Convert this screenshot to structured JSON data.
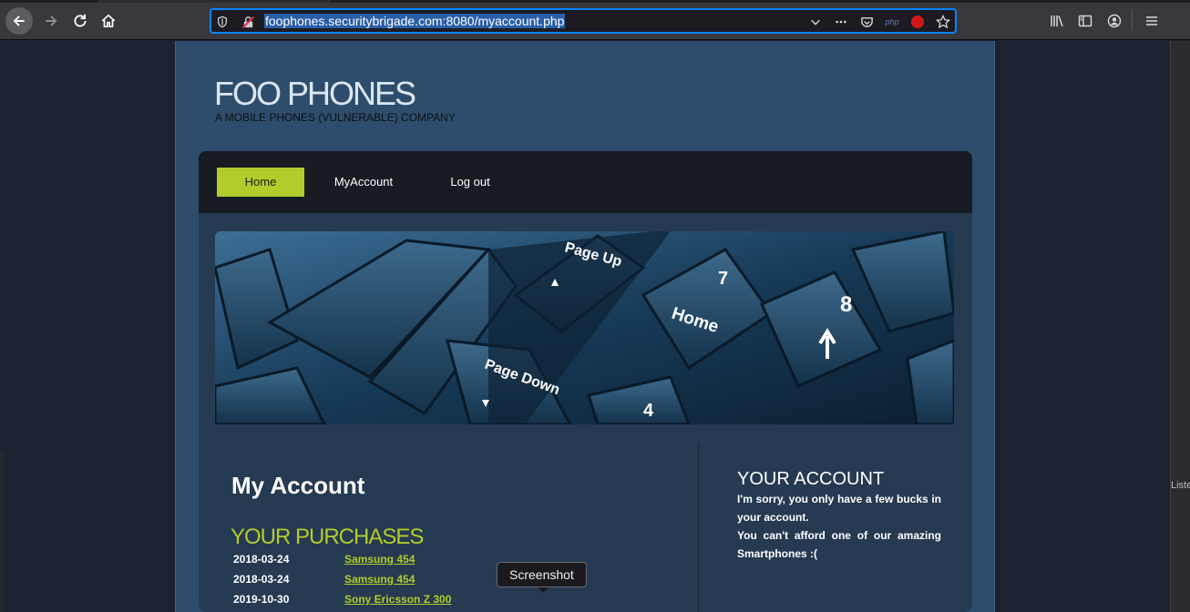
{
  "browser": {
    "url": "foophones.securitybrigade.com:8080/myaccount.php",
    "ext_label": "php"
  },
  "site": {
    "logo": "FOO PHONES",
    "tagline": "A MOBILE PHONES (VULNERABLE) COMPANY",
    "nav": [
      "Home",
      "MyAccount",
      "Log out"
    ],
    "banner_keys": [
      "Page Up",
      "Page Down",
      "Home",
      "7",
      "8",
      "4"
    ]
  },
  "main": {
    "heading": "My Account",
    "purchases_heading": "YOUR PURCHASES",
    "purchases": [
      {
        "date": "2018-03-24",
        "product": "Samsung 454"
      },
      {
        "date": "2018-03-24",
        "product": "Samsung 454"
      },
      {
        "date": "2019-10-30",
        "product": "Sony Ericsson Z 300"
      }
    ]
  },
  "aside": {
    "heading": "YOUR ACCOUNT",
    "message_1": "I'm sorry, you only have a few bucks in your account.",
    "message_2": "You can't afford one of our amazing Smartphones :("
  },
  "tooltip": "Screenshot",
  "side_panel_text": "Liste"
}
